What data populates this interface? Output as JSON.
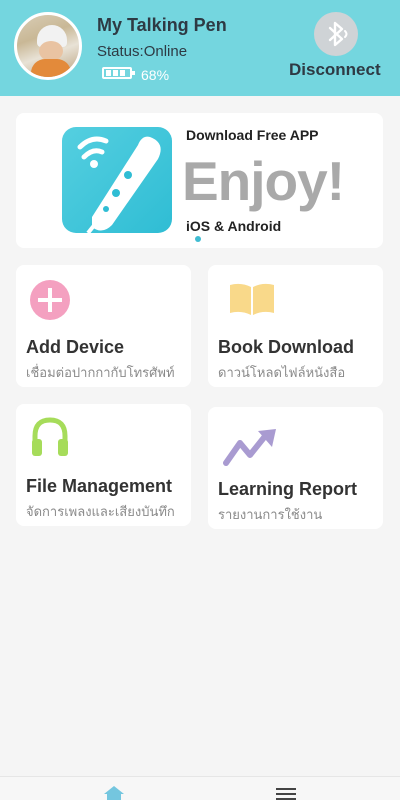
{
  "header": {
    "device_name": "My Talking Pen",
    "status": "Status:Online",
    "battery_percent_text": "68%",
    "battery_level": 0.68,
    "disconnect_label": "Disconnect",
    "background_color": "#74d6df"
  },
  "banner": {
    "download_text": "Download Free APP",
    "headline": "Enjoy!",
    "platforms": "iOS & Android",
    "icon": "talking-pen-wifi-icon"
  },
  "cards": [
    {
      "title": "Add Device",
      "subtitle": "เชื่อมต่อปากกากับโทรศัพท์",
      "icon": "plus-circle-icon",
      "icon_color": "#f4a0c0"
    },
    {
      "title": "Book Download",
      "subtitle": "ดาวน์โหลดไฟล์หนังสือ",
      "icon": "open-book-icon",
      "icon_color": "#f9d98a"
    },
    {
      "title": "File Management",
      "subtitle": "จัดการเพลงและเสียงบันทึก",
      "icon": "headphones-icon",
      "icon_color": "#a6dc5a"
    },
    {
      "title": "Learning Report",
      "subtitle": "รายงานการใช้งาน",
      "icon": "trend-arrow-icon",
      "icon_color": "#a99bd1"
    }
  ],
  "bottom_nav": {
    "items": [
      {
        "icon": "home-icon",
        "active": true
      },
      {
        "icon": "menu-icon",
        "active": false
      }
    ],
    "accent_color": "#74c6df"
  }
}
